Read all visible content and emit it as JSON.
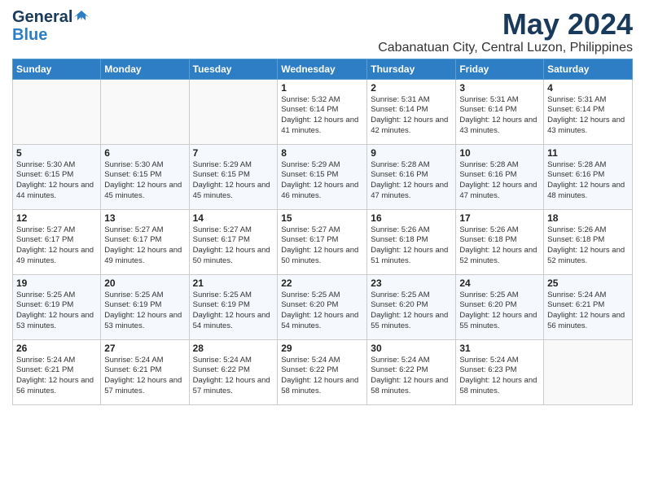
{
  "logo": {
    "general": "General",
    "blue": "Blue"
  },
  "header": {
    "month": "May 2024",
    "location": "Cabanatuan City, Central Luzon, Philippines"
  },
  "weekdays": [
    "Sunday",
    "Monday",
    "Tuesday",
    "Wednesday",
    "Thursday",
    "Friday",
    "Saturday"
  ],
  "weeks": [
    [
      {
        "day": "",
        "sunrise": "",
        "sunset": "",
        "daylight": "",
        "empty": true
      },
      {
        "day": "",
        "sunrise": "",
        "sunset": "",
        "daylight": "",
        "empty": true
      },
      {
        "day": "",
        "sunrise": "",
        "sunset": "",
        "daylight": "",
        "empty": true
      },
      {
        "day": "1",
        "sunrise": "Sunrise: 5:32 AM",
        "sunset": "Sunset: 6:14 PM",
        "daylight": "Daylight: 12 hours and 41 minutes."
      },
      {
        "day": "2",
        "sunrise": "Sunrise: 5:31 AM",
        "sunset": "Sunset: 6:14 PM",
        "daylight": "Daylight: 12 hours and 42 minutes."
      },
      {
        "day": "3",
        "sunrise": "Sunrise: 5:31 AM",
        "sunset": "Sunset: 6:14 PM",
        "daylight": "Daylight: 12 hours and 43 minutes."
      },
      {
        "day": "4",
        "sunrise": "Sunrise: 5:31 AM",
        "sunset": "Sunset: 6:14 PM",
        "daylight": "Daylight: 12 hours and 43 minutes."
      }
    ],
    [
      {
        "day": "5",
        "sunrise": "Sunrise: 5:30 AM",
        "sunset": "Sunset: 6:15 PM",
        "daylight": "Daylight: 12 hours and 44 minutes."
      },
      {
        "day": "6",
        "sunrise": "Sunrise: 5:30 AM",
        "sunset": "Sunset: 6:15 PM",
        "daylight": "Daylight: 12 hours and 45 minutes."
      },
      {
        "day": "7",
        "sunrise": "Sunrise: 5:29 AM",
        "sunset": "Sunset: 6:15 PM",
        "daylight": "Daylight: 12 hours and 45 minutes."
      },
      {
        "day": "8",
        "sunrise": "Sunrise: 5:29 AM",
        "sunset": "Sunset: 6:15 PM",
        "daylight": "Daylight: 12 hours and 46 minutes."
      },
      {
        "day": "9",
        "sunrise": "Sunrise: 5:28 AM",
        "sunset": "Sunset: 6:16 PM",
        "daylight": "Daylight: 12 hours and 47 minutes."
      },
      {
        "day": "10",
        "sunrise": "Sunrise: 5:28 AM",
        "sunset": "Sunset: 6:16 PM",
        "daylight": "Daylight: 12 hours and 47 minutes."
      },
      {
        "day": "11",
        "sunrise": "Sunrise: 5:28 AM",
        "sunset": "Sunset: 6:16 PM",
        "daylight": "Daylight: 12 hours and 48 minutes."
      }
    ],
    [
      {
        "day": "12",
        "sunrise": "Sunrise: 5:27 AM",
        "sunset": "Sunset: 6:17 PM",
        "daylight": "Daylight: 12 hours and 49 minutes."
      },
      {
        "day": "13",
        "sunrise": "Sunrise: 5:27 AM",
        "sunset": "Sunset: 6:17 PM",
        "daylight": "Daylight: 12 hours and 49 minutes."
      },
      {
        "day": "14",
        "sunrise": "Sunrise: 5:27 AM",
        "sunset": "Sunset: 6:17 PM",
        "daylight": "Daylight: 12 hours and 50 minutes."
      },
      {
        "day": "15",
        "sunrise": "Sunrise: 5:27 AM",
        "sunset": "Sunset: 6:17 PM",
        "daylight": "Daylight: 12 hours and 50 minutes."
      },
      {
        "day": "16",
        "sunrise": "Sunrise: 5:26 AM",
        "sunset": "Sunset: 6:18 PM",
        "daylight": "Daylight: 12 hours and 51 minutes."
      },
      {
        "day": "17",
        "sunrise": "Sunrise: 5:26 AM",
        "sunset": "Sunset: 6:18 PM",
        "daylight": "Daylight: 12 hours and 52 minutes."
      },
      {
        "day": "18",
        "sunrise": "Sunrise: 5:26 AM",
        "sunset": "Sunset: 6:18 PM",
        "daylight": "Daylight: 12 hours and 52 minutes."
      }
    ],
    [
      {
        "day": "19",
        "sunrise": "Sunrise: 5:25 AM",
        "sunset": "Sunset: 6:19 PM",
        "daylight": "Daylight: 12 hours and 53 minutes."
      },
      {
        "day": "20",
        "sunrise": "Sunrise: 5:25 AM",
        "sunset": "Sunset: 6:19 PM",
        "daylight": "Daylight: 12 hours and 53 minutes."
      },
      {
        "day": "21",
        "sunrise": "Sunrise: 5:25 AM",
        "sunset": "Sunset: 6:19 PM",
        "daylight": "Daylight: 12 hours and 54 minutes."
      },
      {
        "day": "22",
        "sunrise": "Sunrise: 5:25 AM",
        "sunset": "Sunset: 6:20 PM",
        "daylight": "Daylight: 12 hours and 54 minutes."
      },
      {
        "day": "23",
        "sunrise": "Sunrise: 5:25 AM",
        "sunset": "Sunset: 6:20 PM",
        "daylight": "Daylight: 12 hours and 55 minutes."
      },
      {
        "day": "24",
        "sunrise": "Sunrise: 5:25 AM",
        "sunset": "Sunset: 6:20 PM",
        "daylight": "Daylight: 12 hours and 55 minutes."
      },
      {
        "day": "25",
        "sunrise": "Sunrise: 5:24 AM",
        "sunset": "Sunset: 6:21 PM",
        "daylight": "Daylight: 12 hours and 56 minutes."
      }
    ],
    [
      {
        "day": "26",
        "sunrise": "Sunrise: 5:24 AM",
        "sunset": "Sunset: 6:21 PM",
        "daylight": "Daylight: 12 hours and 56 minutes."
      },
      {
        "day": "27",
        "sunrise": "Sunrise: 5:24 AM",
        "sunset": "Sunset: 6:21 PM",
        "daylight": "Daylight: 12 hours and 57 minutes."
      },
      {
        "day": "28",
        "sunrise": "Sunrise: 5:24 AM",
        "sunset": "Sunset: 6:22 PM",
        "daylight": "Daylight: 12 hours and 57 minutes."
      },
      {
        "day": "29",
        "sunrise": "Sunrise: 5:24 AM",
        "sunset": "Sunset: 6:22 PM",
        "daylight": "Daylight: 12 hours and 58 minutes."
      },
      {
        "day": "30",
        "sunrise": "Sunrise: 5:24 AM",
        "sunset": "Sunset: 6:22 PM",
        "daylight": "Daylight: 12 hours and 58 minutes."
      },
      {
        "day": "31",
        "sunrise": "Sunrise: 5:24 AM",
        "sunset": "Sunset: 6:23 PM",
        "daylight": "Daylight: 12 hours and 58 minutes."
      },
      {
        "day": "",
        "sunrise": "",
        "sunset": "",
        "daylight": "",
        "empty": true
      }
    ]
  ]
}
